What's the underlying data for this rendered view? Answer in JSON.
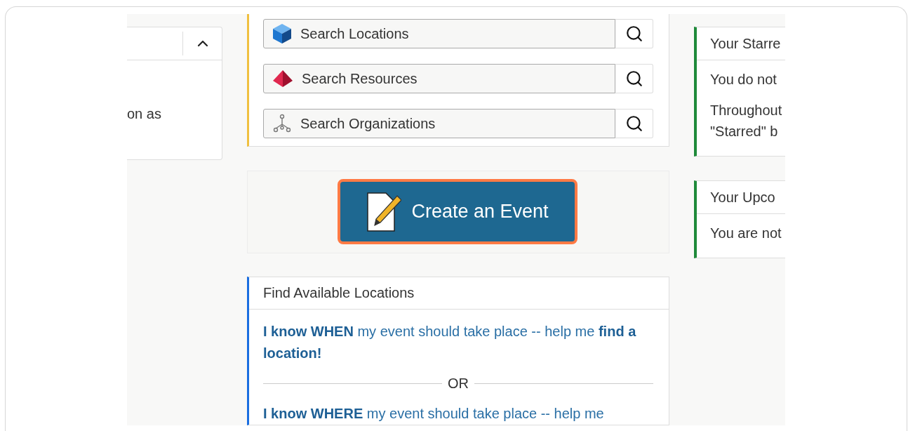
{
  "left_card": {
    "body_text": "on as"
  },
  "search_card": {
    "fields": [
      {
        "kind": "cube",
        "placeholder": "Search Locations"
      },
      {
        "kind": "pyramid",
        "placeholder": "Search Resources"
      },
      {
        "kind": "organization",
        "placeholder": "Search Organizations"
      }
    ]
  },
  "create_button": {
    "label": "Create an Event"
  },
  "find_locations": {
    "title": "Find Available Locations",
    "options": [
      "**I know WHEN** my event should take place -- help me **find a location!**",
      "**I know WHERE** my event should take place -- help me"
    ],
    "divider": "OR"
  },
  "starred": {
    "title": "Your Starre",
    "paragraphs": [
      "You do not",
      "Throughout\n\"Starred\" b"
    ]
  },
  "upcoming": {
    "title": "Your Upco",
    "paragraphs": [
      "You are not"
    ]
  }
}
